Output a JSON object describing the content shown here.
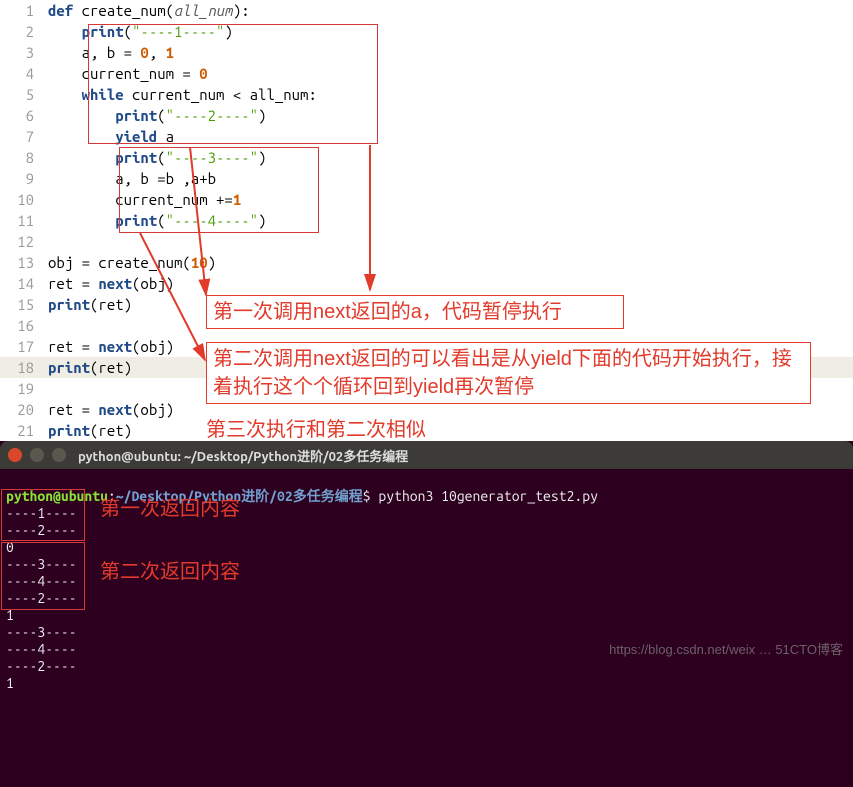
{
  "code": {
    "lines": [
      "1",
      "2",
      "3",
      "4",
      "5",
      "6",
      "7",
      "8",
      "9",
      "10",
      "11",
      "12",
      "13",
      "14",
      "15",
      "16",
      "17",
      "18",
      "19",
      "20",
      "21"
    ],
    "tokens": {
      "def": "def",
      "create_num": "create_num",
      "all_num": "all_num",
      "print": "print",
      "while": "while",
      "yield": "yield",
      "next": "next",
      "s1": "\"----1----\"",
      "s2": "\"----2----\"",
      "s3": "\"----3----\"",
      "s4": "\"----4----\"",
      "n0": "0",
      "n1": "1",
      "n10": "10",
      "assign_ab": "a, b = ",
      "current_num": "current_num",
      "eq0": " = ",
      "lt": " < ",
      "colon": ":",
      "comma": ", ",
      "yield_a": " a",
      "ab_update": "a, b =b ,a+b",
      "cn_inc": " +=",
      "inc1": "1",
      "obj": "obj = create_num(",
      "close": ")",
      "ret_next": "ret = ",
      "next_open": "(obj)",
      "print_ret": "(ret)"
    }
  },
  "annotations": {
    "a1": "第一次调用next返回的a，代码暂停执行",
    "a2": "第二次调用next返回的可以看出是从yield下面的代码开始执行，接着执行这个个循环回到yield再次暂停",
    "a3": "第三次执行和第二次相似"
  },
  "terminal": {
    "title": "python@ubuntu: ~/Desktop/Python进阶/02多任务编程",
    "prompt_user": "python@ubuntu",
    "prompt_sep": ":",
    "prompt_path": "~/Desktop/Python进阶/02多任务编程",
    "prompt_dollar": "$",
    "command": "python3 10generator_test2.py",
    "out": [
      "----1----",
      "----2----",
      "0",
      "----3----",
      "----4----",
      "----2----",
      "1",
      "----3----",
      "----4----",
      "----2----",
      "1"
    ],
    "annot1": "第一次返回内容",
    "annot2": "第二次返回内容"
  },
  "watermark": "https://blog.csdn.net/weix … 51CTO博客"
}
